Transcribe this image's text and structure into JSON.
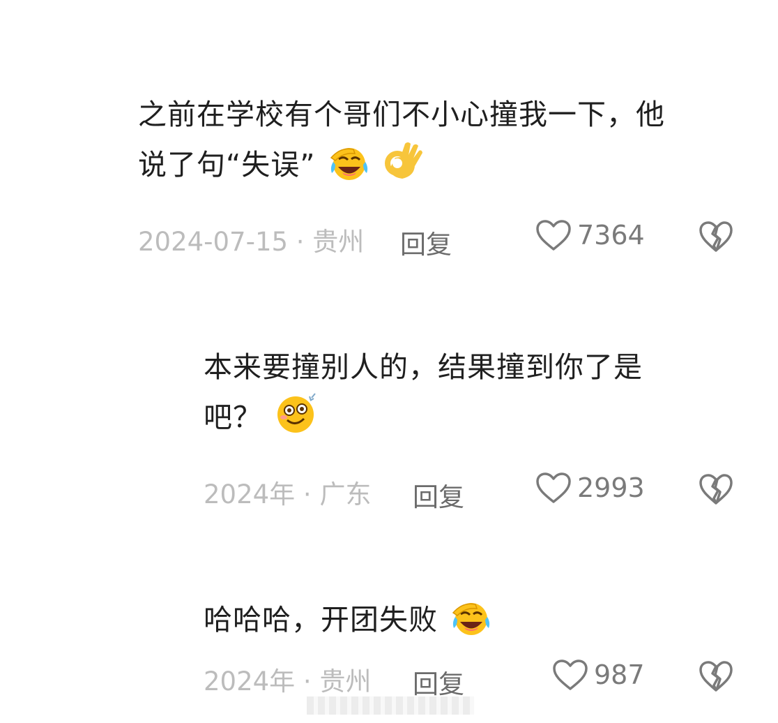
{
  "comments": [
    {
      "text_line1": "之前在学校有个哥们不小心撞我一下，他",
      "text_line2": "说了句“失误”",
      "date": "2024-07-15 · 贵州",
      "reply_label": "回复",
      "likes": "7364"
    },
    {
      "text_line1": "本来要撞别人的，结果撞到你了是",
      "text_line2": "吧？",
      "date": "2024年 · 广东",
      "reply_label": "回复",
      "likes": "2993"
    },
    {
      "text_line1": "哈哈哈，开团失败",
      "date": "2024年 · 贵州",
      "reply_label": "回复",
      "likes": "987"
    }
  ],
  "icons": {
    "like": "heart-outline-icon",
    "dislike": "broken-heart-icon",
    "emoji_laugh": "laughing-face-emoji",
    "emoji_ok": "ok-hand-emoji",
    "emoji_dizzy": "dizzy-face-emoji"
  },
  "colors": {
    "text": "#1f1f1f",
    "meta": "#bcbcbc",
    "reply": "#6b6b6b",
    "icon": "#7a7a7a"
  }
}
